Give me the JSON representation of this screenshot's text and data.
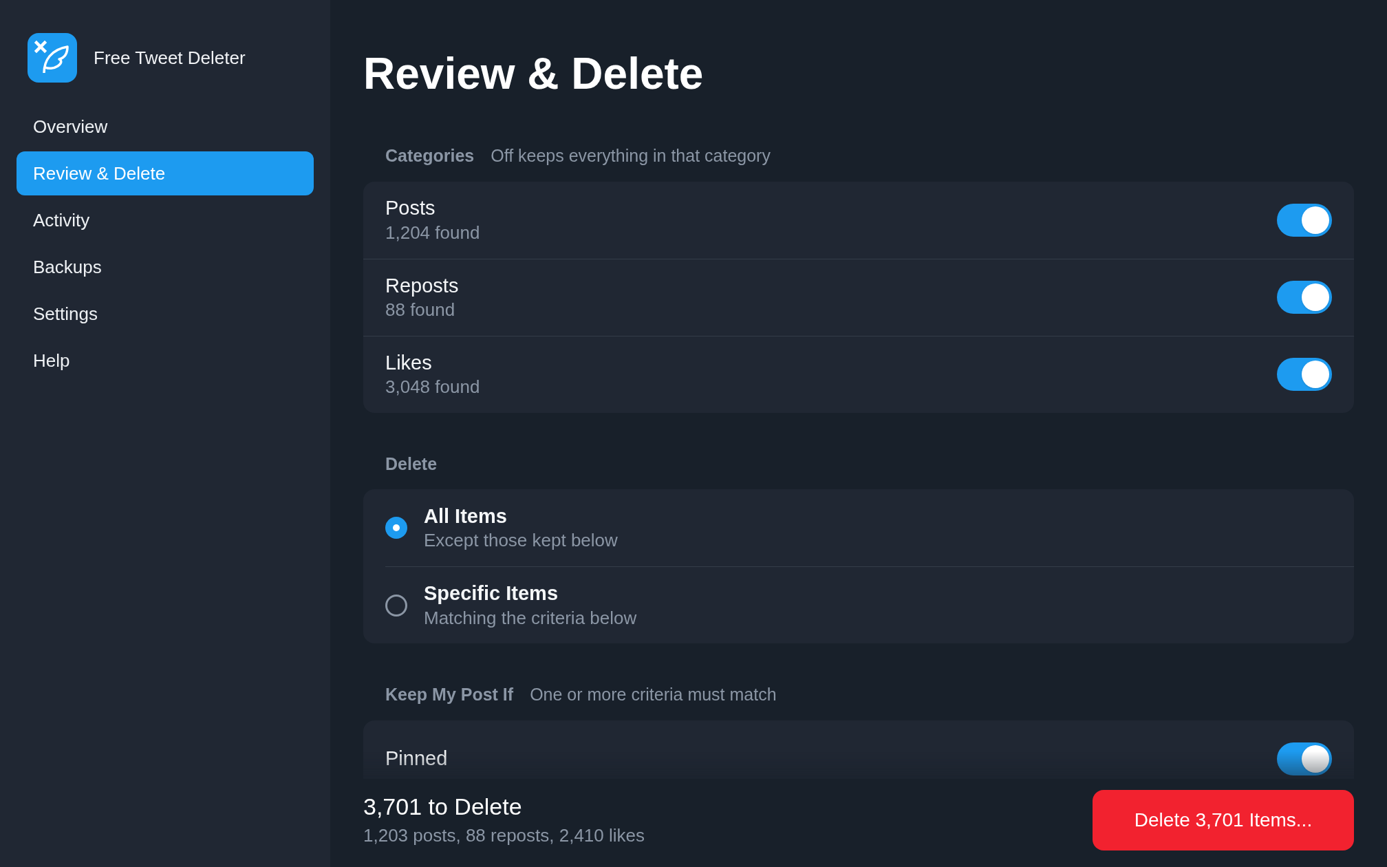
{
  "app": {
    "name": "Free Tweet Deleter"
  },
  "sidebar": {
    "items": [
      {
        "label": "Overview",
        "selected": false
      },
      {
        "label": "Review & Delete",
        "selected": true
      },
      {
        "label": "Activity",
        "selected": false
      },
      {
        "label": "Backups",
        "selected": false
      },
      {
        "label": "Settings",
        "selected": false
      },
      {
        "label": "Help",
        "selected": false
      }
    ]
  },
  "page_title": "Review & Delete",
  "sections": [
    {
      "kind": "toggles",
      "title": "Categories",
      "hint": "Off keeps everything in that category",
      "rows": [
        {
          "label": "Posts",
          "detail": "1,204 found",
          "on": true
        },
        {
          "label": "Reposts",
          "detail": "88 found",
          "on": true
        },
        {
          "label": "Likes",
          "detail": "3,048 found",
          "on": true
        }
      ]
    },
    {
      "kind": "radios",
      "title": "Delete",
      "rows": [
        {
          "label": "All Items",
          "detail": "Except those kept below",
          "selected": true
        },
        {
          "label": "Specific Items",
          "detail": "Matching the criteria below",
          "selected": false
        }
      ]
    },
    {
      "kind": "toggles",
      "title": "Keep My Post If",
      "hint": "One or more criteria must match",
      "rows": [
        {
          "label": "Pinned",
          "on": true
        }
      ]
    }
  ],
  "footer": {
    "summary": "3,701 to Delete",
    "breakdown": "1,203 posts, 88 reposts, 2,410 likes",
    "button": "Delete 3,701 Items..."
  }
}
